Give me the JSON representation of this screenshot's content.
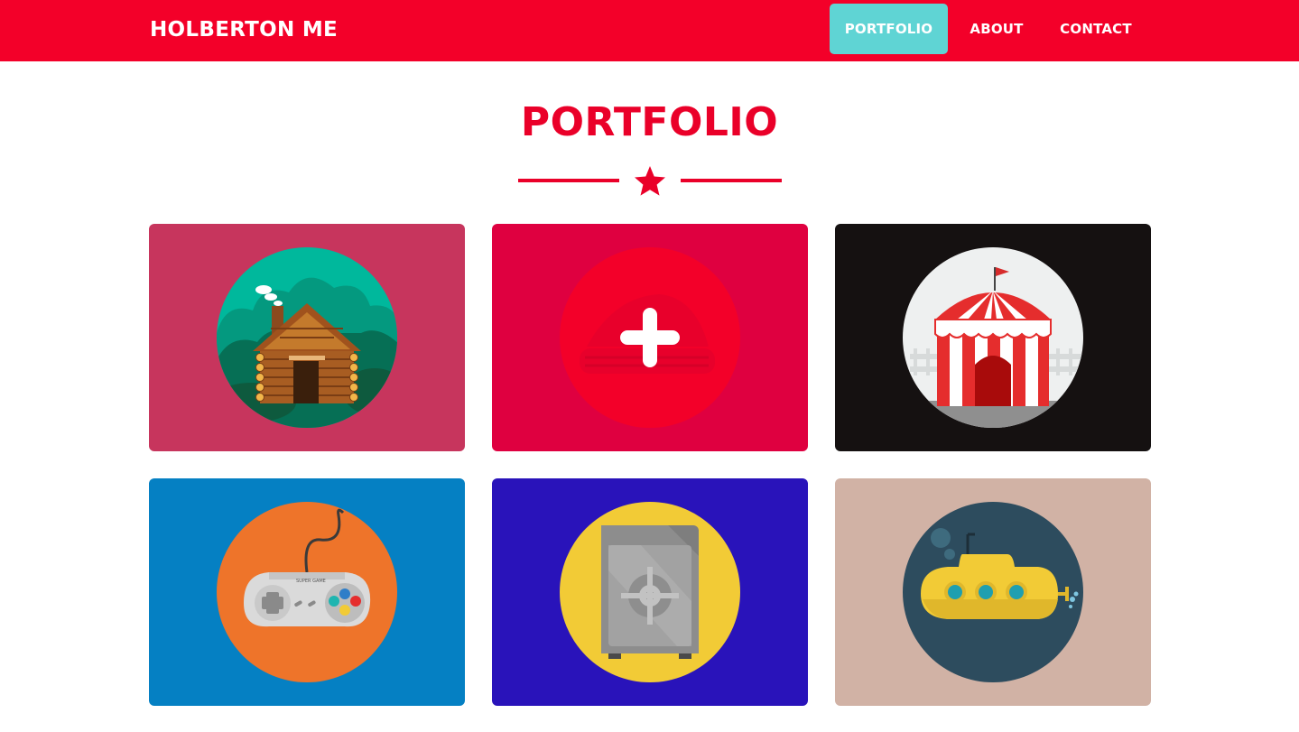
{
  "navbar": {
    "brand": "HOLBERTON ME",
    "items": [
      {
        "label": "PORTFOLIO",
        "active": true
      },
      {
        "label": "ABOUT",
        "active": false
      },
      {
        "label": "CONTACT",
        "active": false
      }
    ],
    "colors": {
      "background": "#f30029",
      "active_item": "#5fd4d4",
      "text": "#ffffff"
    }
  },
  "section": {
    "title": "PORTFOLIO",
    "divider_icon": "star-icon",
    "accent": "#ea0029"
  },
  "portfolio": {
    "items": [
      {
        "name": "cabin",
        "icon": "log-cabin-icon",
        "background": "#c7355d",
        "circle": "#00b89c"
      },
      {
        "name": "cake",
        "icon": "plus-icon",
        "background": "#df0040",
        "circle": "#f30029"
      },
      {
        "name": "circus",
        "icon": "circus-tent-icon",
        "background": "#151111",
        "circle": "#eef0f0"
      },
      {
        "name": "game",
        "icon": "game-controller-icon",
        "background": "#0580c3",
        "circle": "#ee742a",
        "controller_label": "SUPER GAME"
      },
      {
        "name": "safe",
        "icon": "safe-icon",
        "background": "#2913ba",
        "circle": "#f2cb36"
      },
      {
        "name": "submarine",
        "icon": "submarine-icon",
        "background": "#d1b2a5",
        "circle": "#2d4c5e"
      }
    ]
  }
}
